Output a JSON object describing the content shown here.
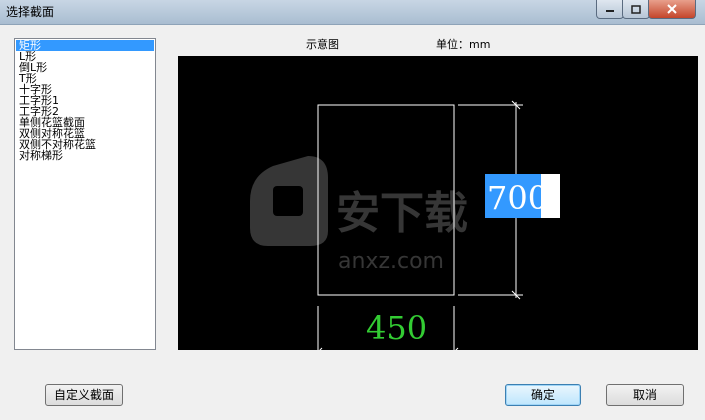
{
  "window": {
    "title": "选择截面"
  },
  "section_list": {
    "items": [
      "矩形",
      "L形",
      "倒L形",
      "T形",
      "十字形",
      "工字形1",
      "工字形2",
      "单侧花篮截面",
      "双侧对称花篮",
      "双侧不对称花篮",
      "对称梯形"
    ],
    "selected": "矩形"
  },
  "preview": {
    "caption": "示意图",
    "unit_label": "单位：mm",
    "height_value": "700",
    "width_value": "450",
    "watermark_text": "安下载",
    "watermark_sub": "anxz.com"
  },
  "buttons": {
    "custom_section": "自定义截面",
    "ok": "确定",
    "cancel": "取消"
  },
  "colors": {
    "preview_bg": "#000000",
    "outline": "#ffffff",
    "dimension_text": "#33cc33",
    "selection": "#3399ff"
  }
}
